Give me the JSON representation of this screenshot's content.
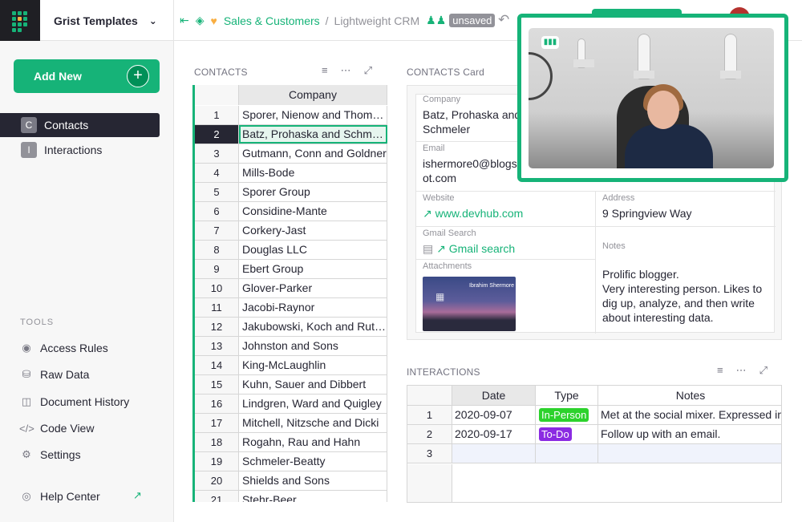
{
  "org": {
    "name": "Grist Templates"
  },
  "breadcrumb": {
    "workspace": "Sales & Customers",
    "document": "Lightweight CRM",
    "status": "unsaved"
  },
  "sidebar": {
    "add_new": "Add New",
    "pages": [
      {
        "icon": "C",
        "label": "Contacts",
        "active": true
      },
      {
        "icon": "I",
        "label": "Interactions",
        "active": false
      }
    ],
    "tools_header": "TOOLS",
    "tools": [
      {
        "icon": "eye-icon",
        "label": "Access Rules"
      },
      {
        "icon": "database-icon",
        "label": "Raw Data"
      },
      {
        "icon": "history-icon",
        "label": "Document History"
      },
      {
        "icon": "code-icon",
        "label": "Code View"
      },
      {
        "icon": "gear-icon",
        "label": "Settings"
      }
    ],
    "help": "Help Center"
  },
  "contacts": {
    "title": "CONTACTS",
    "column": "Company",
    "selected_row": 2,
    "rows": [
      "Sporer, Nienow and Thompson",
      "Batz, Prohaska and Schmeler",
      "Gutmann, Conn and Goldner",
      "Mills-Bode",
      "Sporer Group",
      "Considine-Mante",
      "Corkery-Jast",
      "Douglas LLC",
      "Ebert Group",
      "Glover-Parker",
      "Jacobi-Raynor",
      "Jakubowski, Koch and Rutherford",
      "Johnston and Sons",
      "King-McLaughlin",
      "Kuhn, Sauer and Dibbert",
      "Lindgren, Ward and Quigley",
      "Mitchell, Nitzsche and Dicki",
      "Rogahn, Rau and Hahn",
      "Schmeler-Beatty",
      "Shields and Sons",
      "Stehr-Beer"
    ]
  },
  "card": {
    "title": "CONTACTS Card",
    "company_label": "Company",
    "company_value": "Batz, Prohaska and Schmeler",
    "email_label": "Email",
    "email_value": "ishermore0@blogspot.com",
    "website_label": "Website",
    "website_value": "www.devhub.com",
    "address_label": "Address",
    "address_value": "9 Springview Way",
    "gmail_label": "Gmail Search",
    "gmail_value": "Gmail search",
    "notes_label": "Notes",
    "notes_value": "Prolific blogger.\nVery interesting person. Likes to dig up, analyze, and then write about interesting data.",
    "attachments_label": "Attachments",
    "attachment_name": "Ibrahim Shermore"
  },
  "interactions": {
    "title": "INTERACTIONS",
    "columns": [
      "Date",
      "Type",
      "Notes"
    ],
    "rows": [
      {
        "n": "1",
        "date": "2020-09-07",
        "type": "In-Person",
        "type_color": "#2cd22c",
        "notes": "Met at the social mixer. Expressed interest"
      },
      {
        "n": "2",
        "date": "2020-09-17",
        "type": "To-Do",
        "type_color": "#8b2be2",
        "notes": "Follow up with an email."
      },
      {
        "n": "3",
        "date": "",
        "type": "",
        "type_color": "",
        "notes": ""
      }
    ]
  },
  "colors": {
    "accent": "#16b378",
    "dark": "#262633"
  }
}
